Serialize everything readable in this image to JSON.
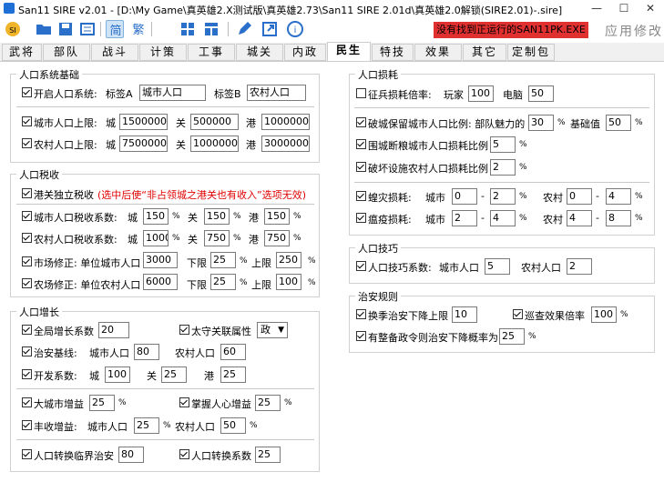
{
  "window": {
    "title": "San11 SIRE v2.01 - [D:\\My Game\\真英雄2.X测试版\\真英雄2.73\\San11 SIRE 2.01d\\真英雄2.0解锁(SIRE2.01)-.sire]",
    "minimize": "—",
    "maximize": "☐",
    "close": "✕"
  },
  "toolbar": {
    "status": "没有找到正运行的SAN11PK.EXE",
    "brand": "应用修改"
  },
  "tabs": [
    "武将",
    "部队",
    "战斗",
    "计策",
    "工事",
    "城关",
    "内政",
    "民生",
    "特技",
    "效果",
    "其它",
    "定制包"
  ],
  "population_base": {
    "title": "人口系统基础",
    "enable_label": "开启人口系统:",
    "tag_a_label": "标签A",
    "tag_a": "城市人口",
    "tag_b_label": "标签B",
    "tag_b": "农村人口",
    "city_cap_label": "城市人口上限:",
    "farm_cap_label": "农村人口上限:",
    "city_lbl": "城",
    "pass_lbl": "关",
    "port_lbl": "港",
    "city_cap": [
      "1500000",
      "500000",
      "1000000"
    ],
    "farm_cap": [
      "7500000",
      "1000000",
      "3000000"
    ]
  },
  "tax": {
    "title": "人口税收",
    "independent_label": "港关独立税收",
    "note": "(选中后使“非占领城之港关也有收入”选项无效)",
    "city_rate_label": "城市人口税收系数:",
    "farm_rate_label": "农村人口税收系数:",
    "city_lbl": "城",
    "pass_lbl": "关",
    "port_lbl": "港",
    "city_rate": [
      "150",
      "150",
      "150"
    ],
    "farm_rate": [
      "1000",
      "750",
      "750"
    ],
    "market_label": "市场修正: 单位城市人口",
    "farm_fix_label": "农场修正: 单位农村人口",
    "lower_label": "下限",
    "upper_label": "上限",
    "market": [
      "3000",
      "25",
      "250"
    ],
    "farm": [
      "6000",
      "25",
      "100"
    ]
  },
  "growth": {
    "title": "人口增长",
    "global_label": "全局增长系数",
    "global": "20",
    "governor_label": "太守关联属性",
    "governor": "政",
    "security_label": "治安基线:",
    "city_pop_label": "城市人口",
    "farm_pop_label": "农村人口",
    "security": [
      "80",
      "60"
    ],
    "develop_label": "开发系数:",
    "city_lbl": "城",
    "pass_lbl": "关",
    "port_lbl": "港",
    "develop": [
      "100",
      "25",
      "25"
    ],
    "big_city_label": "大城市增益",
    "big_city": "25",
    "popular_label": "掌握人心增益",
    "popular": "25",
    "harvest_label": "丰收增益:",
    "harvest_city_label": "城市人口",
    "harvest_farm_label": "农村人口",
    "harvest": [
      "25",
      "50"
    ],
    "convert_critical_label": "人口转换临界治安",
    "convert_critical": "80",
    "convert_rate_label": "人口转换系数",
    "convert_rate": "25"
  },
  "loss": {
    "title": "人口损耗",
    "conscript_label": "征兵损耗倍率:",
    "player_label": "玩家",
    "player": "100",
    "ai_label": "电脑",
    "ai": "50",
    "siege_label": "破城保留城市人口比例: 部队魅力的",
    "siege": "30",
    "base_label": "基础值",
    "base": "50",
    "encircle_label": "围城断粮城市人口损耗比例",
    "encircle": "5",
    "destroy_label": "破坏设施农村人口损耗比例",
    "destroy": "2",
    "locust_label": "蝗灾损耗:",
    "plague_label": "瘟疫损耗:",
    "city_pop_label": "城市",
    "farm_pop_label": "农村",
    "locust": [
      "0",
      "2",
      "0",
      "4"
    ],
    "plague": [
      "2",
      "4",
      "4",
      "8"
    ]
  },
  "skill": {
    "title": "人口技巧",
    "rate_label": "人口技巧系数:",
    "city_pop_label": "城市人口",
    "city": "5",
    "farm_pop_label": "农村人口",
    "farm": "2"
  },
  "security": {
    "title": "治安规则",
    "season_label": "换季治安下降上限",
    "season": "10",
    "patrol_label": "巡查效果倍率",
    "patrol": "100",
    "order_label": "有整备政令则治安下降概率为",
    "order": "25"
  },
  "colors": {
    "status_bg": "#e03030",
    "note": "#e00000"
  }
}
